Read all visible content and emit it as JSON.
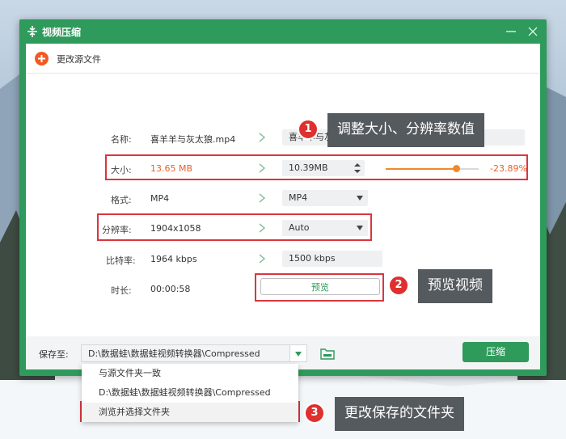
{
  "window": {
    "title": "视频压缩"
  },
  "toolbar": {
    "add_label": "更改源文件"
  },
  "rows": {
    "name": {
      "label": "名称:",
      "source": "喜羊羊与灰太狼.mp4",
      "output": "喜羊羊与灰太狼_compressed.mp4"
    },
    "size": {
      "label": "大小:",
      "source": "13.65 MB",
      "output": "10.39MB",
      "percent": "-23.89%",
      "slider_level": 0.76
    },
    "format": {
      "label": "格式:",
      "source": "MP4",
      "output": "MP4"
    },
    "resolution": {
      "label": "分辨率:",
      "source": "1904x1058",
      "output": "Auto"
    },
    "bitrate": {
      "label": "比特率:",
      "source": "1964 kbps",
      "output": "1500 kbps"
    },
    "duration": {
      "label": "时长:",
      "source": "00:00:58",
      "preview_label": "预览"
    }
  },
  "bottom": {
    "save_label": "保存至:",
    "path": "D:\\数据蛙\\数据蛙视频转换器\\Compressed",
    "compress_label": "压缩"
  },
  "dropdown": {
    "items": [
      "与源文件夹一致",
      "D:\\数据蛙\\数据蛙视频转换器\\Compressed",
      "浏览并选择文件夹"
    ]
  },
  "callouts": [
    {
      "number": "1",
      "text": "调整大小、分辨率数值"
    },
    {
      "number": "2",
      "text": "预览视频"
    },
    {
      "number": "3",
      "text": "更改保存的文件夹"
    }
  ],
  "colors": {
    "brand_green": "#2e9a5b",
    "accent_orange": "#f0892b",
    "highlight_red": "#d9363e"
  },
  "icons": [
    "compress-icon",
    "minimize-icon",
    "close-icon",
    "plus-icon",
    "chevron-right-icon",
    "caret-down-icon",
    "folder-icon"
  ]
}
